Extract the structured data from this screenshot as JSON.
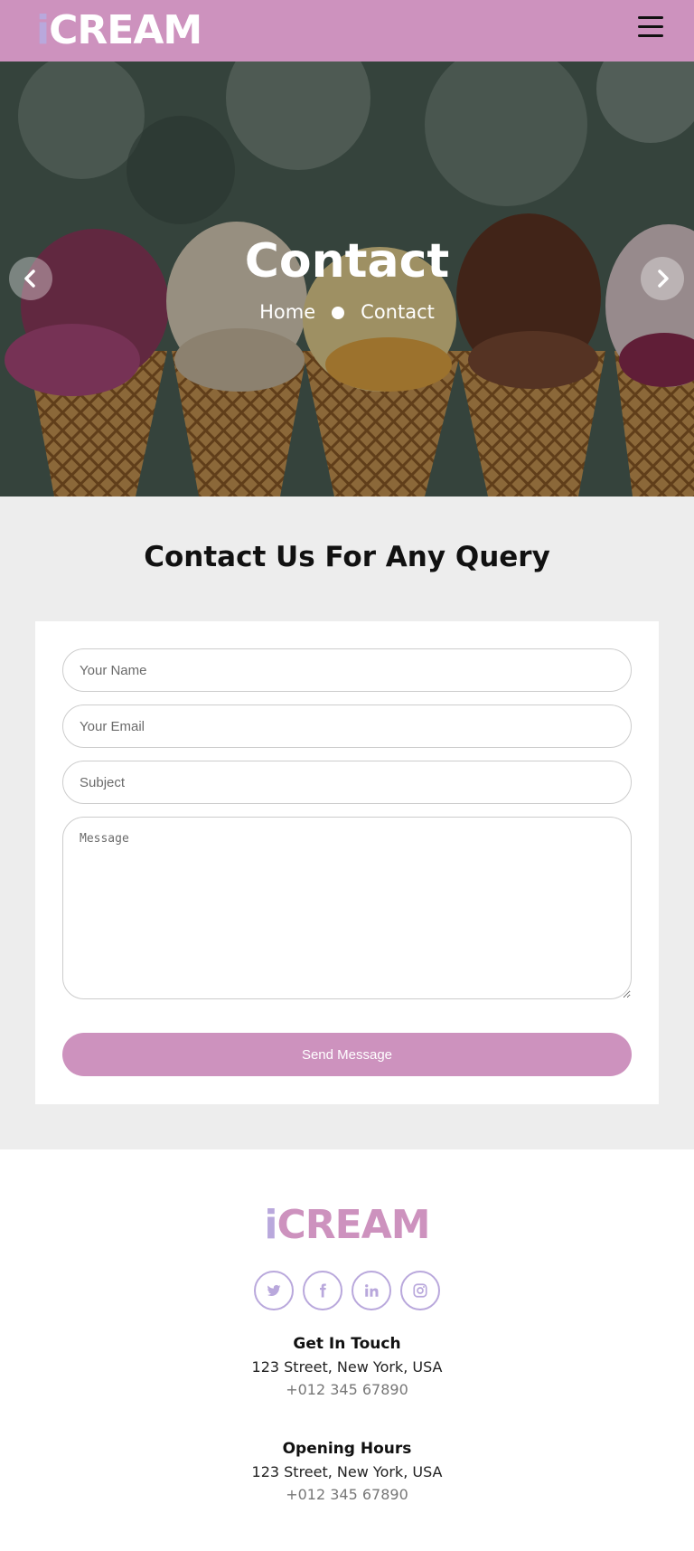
{
  "brand": {
    "lead": "i",
    "rest": "CREAM"
  },
  "hero": {
    "title": "Contact",
    "breadcrumb": {
      "home": "Home",
      "current": "Contact"
    }
  },
  "contact": {
    "title": "Contact Us For Any Query",
    "form": {
      "name_placeholder": "Your Name",
      "email_placeholder": "Your Email",
      "subject_placeholder": "Subject",
      "message_placeholder": "Message",
      "send_label": "Send Message"
    }
  },
  "footer": {
    "brand": {
      "lead": "i",
      "rest": "CREAM"
    },
    "socials": [
      "twitter-icon",
      "facebook-icon",
      "linkedin-icon",
      "instagram-icon"
    ],
    "get_in_touch": {
      "heading": "Get In Touch",
      "address": "123 Street, New York, USA",
      "phone": "+012 345 67890"
    },
    "opening_hours": {
      "heading": "Opening Hours",
      "address": "123 Street, New York, USA",
      "phone": "+012 345 67890"
    }
  },
  "colors": {
    "accent": "#CD92BE",
    "secondary": "#B9A8DC",
    "section_bg": "#EDEDED"
  }
}
